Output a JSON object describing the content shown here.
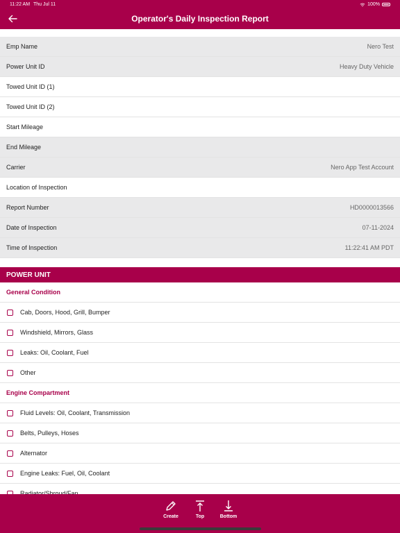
{
  "status": {
    "time": "11:22 AM",
    "date": "Thu Jul 11",
    "battery": "100%"
  },
  "header": {
    "title": "Operator's Daily Inspection Report"
  },
  "fields": [
    {
      "label": "Emp Name",
      "value": "Nero Test",
      "shade": "gray"
    },
    {
      "label": "Power Unit ID",
      "value": "Heavy Duty Vehicle",
      "shade": "gray"
    },
    {
      "label": "Towed Unit ID (1)",
      "value": "",
      "shade": "white"
    },
    {
      "label": "Towed Unit ID (2)",
      "value": "",
      "shade": "white"
    },
    {
      "label": "Start Mileage",
      "value": "",
      "shade": "white"
    },
    {
      "label": "End Mileage",
      "value": "",
      "shade": "gray"
    },
    {
      "label": "Carrier",
      "value": "Nero App Test Account",
      "shade": "gray"
    },
    {
      "label": "Location of Inspection",
      "value": "",
      "shade": "white"
    },
    {
      "label": "Report Number",
      "value": "HD0000013566",
      "shade": "gray"
    },
    {
      "label": "Date of Inspection",
      "value": "07-11-2024",
      "shade": "gray"
    },
    {
      "label": "Time of Inspection",
      "value": "11:22:41 AM PDT",
      "shade": "gray"
    }
  ],
  "section": {
    "title": "POWER UNIT"
  },
  "groups": [
    {
      "title": "General Condition",
      "items": [
        "Cab, Doors, Hood, Grill, Bumper",
        "Windshield, Mirrors, Glass",
        "Leaks: Oil, Coolant, Fuel",
        "Other"
      ]
    },
    {
      "title": "Engine Compartment",
      "items": [
        "Fluid Levels: Oil, Coolant, Transmission",
        "Belts, Pulleys, Hoses",
        "Alternator",
        "Engine Leaks: Fuel, Oil, Coolant",
        "Radiator/Shroud/Fan"
      ]
    }
  ],
  "footer": {
    "create_label": "Create",
    "top_label": "Top",
    "bottom_label": "Bottom"
  },
  "colors": {
    "brand": "#a8004a",
    "row_gray": "#e9e9ea"
  }
}
